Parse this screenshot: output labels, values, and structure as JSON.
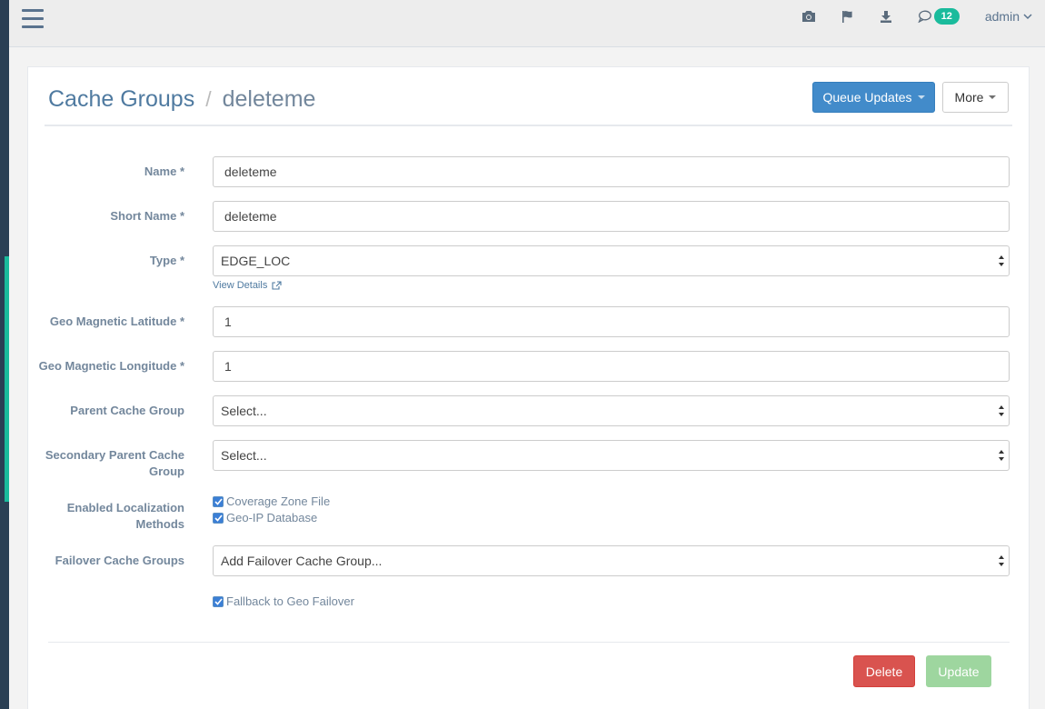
{
  "topbar": {
    "icons": [
      "hamburger-icon",
      "camera-icon",
      "flag-icon",
      "download-icon",
      "chat-icon"
    ],
    "notification_count": "12",
    "user": "admin"
  },
  "page": {
    "breadcrumb_parent": "Cache Groups",
    "breadcrumb_separator": "/",
    "breadcrumb_current": "deleteme",
    "queue_updates_label": "Queue Updates",
    "more_label": "More"
  },
  "form": {
    "name_label": "Name",
    "name_value": "deleteme",
    "short_name_label": "Short Name",
    "short_name_value": "deleteme",
    "type_label": "Type",
    "type_value": "EDGE_LOC",
    "view_details": "View Details",
    "lat_label": "Geo Magnetic Latitude",
    "lat_value": "1",
    "lon_label": "Geo Magnetic Longitude",
    "lon_value": "1",
    "parent_label": "Parent Cache Group",
    "parent_value": "Select...",
    "secondary_parent_label_1": "Secondary Parent Cache",
    "secondary_parent_label_2": "Group",
    "secondary_parent_value": "Select...",
    "localization_label_1": "Enabled Localization",
    "localization_label_2": "Methods",
    "coverage_zone": "Coverage Zone File",
    "geo_ip": "Geo-IP Database",
    "failover_label": "Failover Cache Groups",
    "failover_value": "Add Failover Cache Group...",
    "fallback_label": "Fallback to Geo Failover",
    "required_mark": "*"
  },
  "actions": {
    "delete_label": "Delete",
    "update_label": "Update"
  },
  "colors": {
    "primary": "#428bca",
    "danger": "#d9534f",
    "success_disabled": "#9ed69f",
    "badge": "#1abb9c"
  }
}
